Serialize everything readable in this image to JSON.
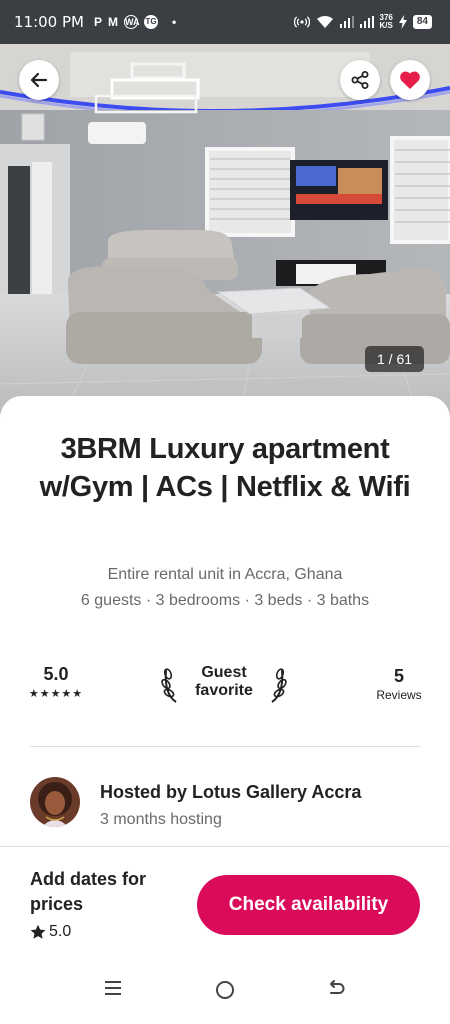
{
  "status_bar": {
    "time": "11:00 PM",
    "app_icons": [
      "P",
      "M",
      "WA",
      "TG"
    ],
    "dot": "•",
    "net_speed_value": "376",
    "net_speed_unit": "K/S",
    "battery": "84"
  },
  "photo": {
    "counter": "1 / 61"
  },
  "listing": {
    "title": "3BRM Luxury apartment w/Gym | ACs | Netflix & Wifi",
    "subtitle": "Entire rental unit in Accra, Ghana",
    "details": "6 guests · 3 bedrooms · 3 beds · 3 baths"
  },
  "highlights": {
    "rating": "5.0",
    "stars": "★★★★★",
    "guest_favorite": "Guest favorite",
    "reviews_count": "5",
    "reviews_label": "Reviews"
  },
  "host": {
    "name": "Hosted by Lotus Gallery Accra",
    "duration": "3 months hosting"
  },
  "booking": {
    "label": "Add dates for prices",
    "rating": "5.0",
    "button": "Check availability"
  },
  "icons": {
    "back": "arrow-left-icon",
    "share": "share-icon",
    "favorite": "heart-icon",
    "star": "star-icon",
    "laurel": "laurel-icon"
  },
  "colors": {
    "accent": "#db0b5b",
    "favorite_heart": "#e51d48",
    "text_primary": "#222222",
    "text_secondary": "#6a6a6a"
  }
}
